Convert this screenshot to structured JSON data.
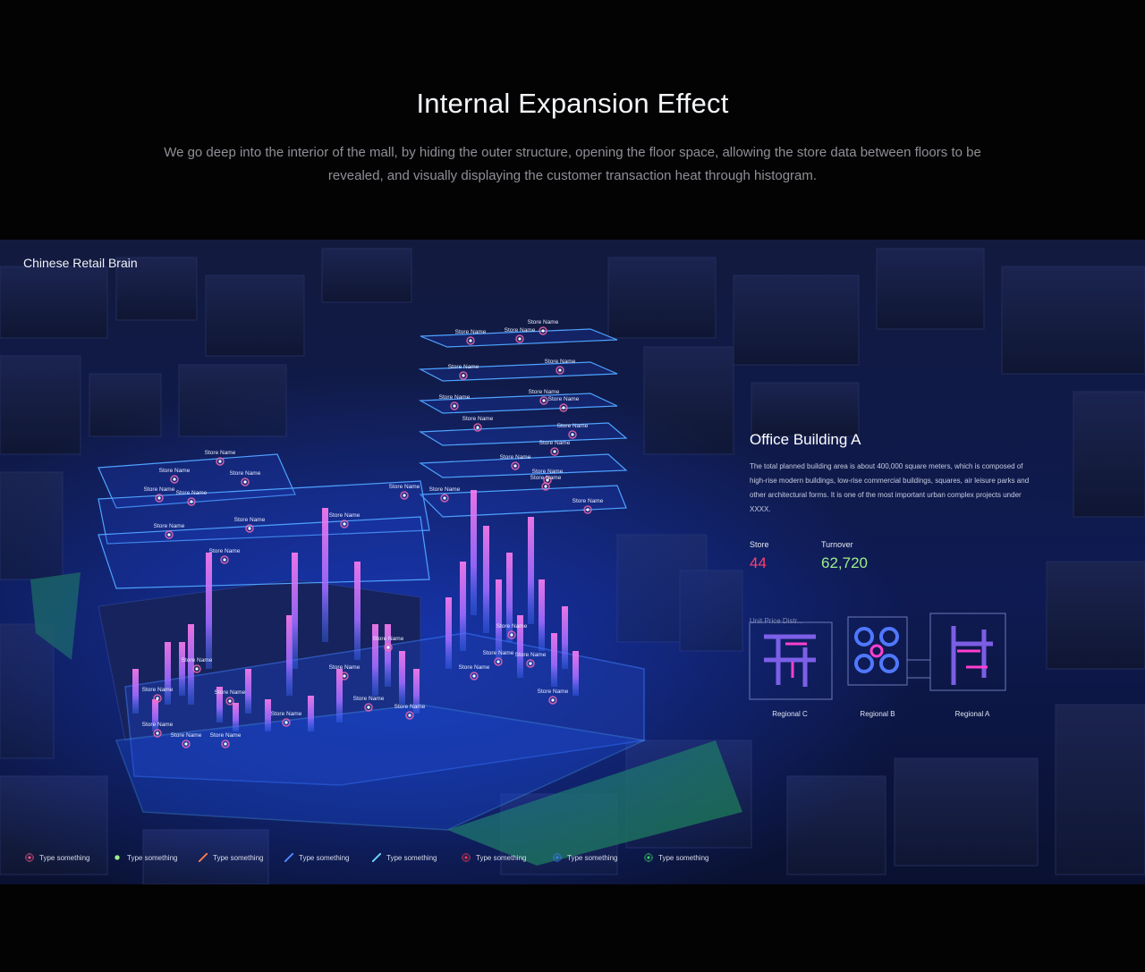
{
  "hero": {
    "title": "Internal Expansion Effect",
    "description": "We go deep into the interior of the mall, by hiding the outer structure, opening the floor space, allowing the store data between floors to be revealed, and visually displaying the customer transaction heat through histogram."
  },
  "app": {
    "title": "Chinese Retail Brain"
  },
  "map": {
    "store_label": "Store Name"
  },
  "panel": {
    "title": "Office Building A",
    "description": "The total planned building area is about 400,000 square meters, which is composed of high-rise modern buildings, low-rise commercial buildings, squares, air leisure parks and other architectural forms. It is one of the most important urban complex projects under XXXX.",
    "stats": [
      {
        "label": "Store",
        "value": "44",
        "color": "#ff3f74"
      },
      {
        "label": "Turnover",
        "value": "62,720",
        "color": "#9ef08a"
      }
    ],
    "unit_price_label": "Unit Price Distr...",
    "regions": [
      {
        "label": "Regional C"
      },
      {
        "label": "Regional B"
      },
      {
        "label": "Regional A"
      }
    ]
  },
  "legend": [
    {
      "label": "Type something",
      "icon": "pink-ring-dot",
      "color": "#ff5b8a"
    },
    {
      "label": "Type something",
      "icon": "green-dot",
      "color": "#9ef08a"
    },
    {
      "label": "Type something",
      "icon": "orange-slash",
      "color": "#ff7a4a"
    },
    {
      "label": "Type something",
      "icon": "blue-slash",
      "color": "#4f8cff"
    },
    {
      "label": "Type something",
      "icon": "cyan-slash",
      "color": "#6fd6ff"
    },
    {
      "label": "Type something",
      "icon": "red-ring-dot",
      "color": "#ff3b4f"
    },
    {
      "label": "Type something",
      "icon": "blue-ring-dot",
      "color": "#3e7bff"
    },
    {
      "label": "Type something",
      "icon": "green-ring-dot",
      "color": "#3bd36a"
    }
  ]
}
